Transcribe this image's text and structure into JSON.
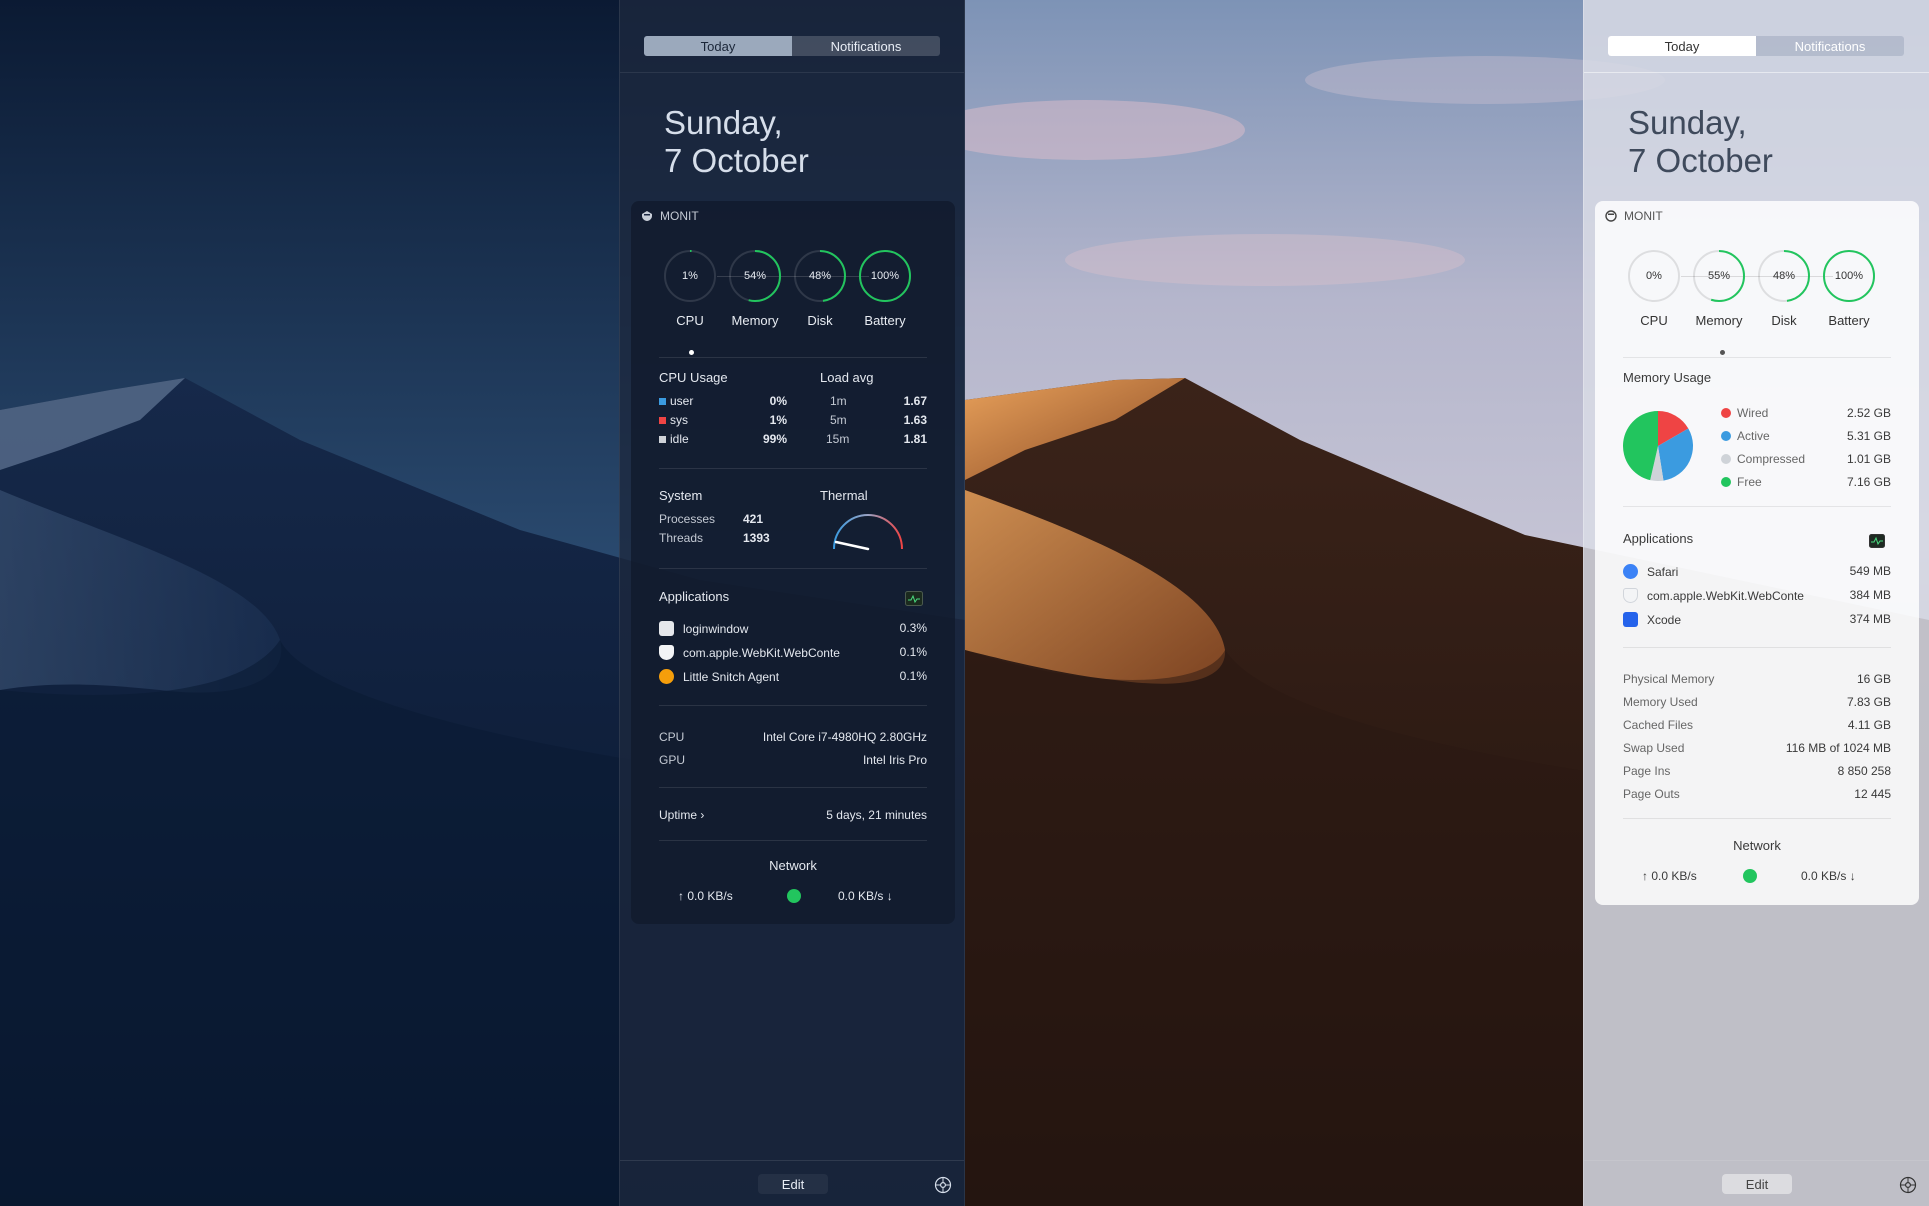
{
  "tabs": {
    "today": "Today",
    "notifications": "Notifications"
  },
  "date": {
    "line1": "Sunday,",
    "line2": "7 October"
  },
  "footer": {
    "edit": "Edit",
    "settings_icon": "gear-icon"
  },
  "colors": {
    "ring_green": "#22c55e",
    "user_blue": "#3b9be0",
    "sys_red": "#ef4444",
    "wired_red": "#ef4444",
    "active_blue": "#3b9be0",
    "compressed_gray": "#cfd3d8",
    "free_green": "#22c55e"
  },
  "dark": {
    "title": "MONIT",
    "gauges": [
      {
        "label": "CPU",
        "value": "1%",
        "fraction": 0.01
      },
      {
        "label": "Memory",
        "value": "54%",
        "fraction": 0.54
      },
      {
        "label": "Disk",
        "value": "48%",
        "fraction": 0.48
      },
      {
        "label": "Battery",
        "value": "100%",
        "fraction": 1.0
      }
    ],
    "cpu_usage": {
      "title": "CPU Usage",
      "rows": [
        {
          "label": "user",
          "value": "0%"
        },
        {
          "label": "sys",
          "value": "1%"
        },
        {
          "label": "idle",
          "value": "99%"
        }
      ]
    },
    "load_avg": {
      "title": "Load avg",
      "rows": [
        {
          "label": "1m",
          "value": "1.67"
        },
        {
          "label": "5m",
          "value": "1.63"
        },
        {
          "label": "15m",
          "value": "1.81"
        }
      ]
    },
    "system": {
      "title": "System",
      "processes_label": "Processes",
      "processes": "421",
      "threads_label": "Threads",
      "threads": "1393"
    },
    "thermal": {
      "title": "Thermal"
    },
    "applications": {
      "title": "Applications",
      "items": [
        {
          "name": "loginwindow",
          "value": "0.3%"
        },
        {
          "name": "com.apple.WebKit.WebConte",
          "value": "0.1%"
        },
        {
          "name": "Little Snitch Agent",
          "value": "0.1%"
        }
      ]
    },
    "hardware": {
      "cpu_label": "CPU",
      "cpu": "Intel Core i7-4980HQ 2.80GHz",
      "gpu_label": "GPU",
      "gpu": "Intel Iris Pro"
    },
    "uptime": {
      "label": "Uptime ›",
      "value": "5 days, 21 minutes"
    },
    "network": {
      "title": "Network",
      "up": "↑ 0.0 KB/s",
      "down": "0.0 KB/s ↓"
    }
  },
  "light": {
    "title": "MONIT",
    "gauges": [
      {
        "label": "CPU",
        "value": "0%",
        "fraction": 0.0
      },
      {
        "label": "Memory",
        "value": "55%",
        "fraction": 0.55
      },
      {
        "label": "Disk",
        "value": "48%",
        "fraction": 0.48
      },
      {
        "label": "Battery",
        "value": "100%",
        "fraction": 1.0
      }
    ],
    "memory_usage": {
      "title": "Memory Usage",
      "legend": [
        {
          "label": "Wired",
          "value": "2.52 GB"
        },
        {
          "label": "Active",
          "value": "5.31 GB"
        },
        {
          "label": "Compressed",
          "value": "1.01 GB"
        },
        {
          "label": "Free",
          "value": "7.16 GB"
        }
      ]
    },
    "applications": {
      "title": "Applications",
      "items": [
        {
          "name": "Safari",
          "value": "549 MB"
        },
        {
          "name": "com.apple.WebKit.WebConte",
          "value": "384 MB"
        },
        {
          "name": "Xcode",
          "value": "374 MB"
        }
      ]
    },
    "stats": [
      {
        "label": "Physical Memory",
        "value": "16 GB"
      },
      {
        "label": "Memory Used",
        "value": "7.83 GB"
      },
      {
        "label": "Cached Files",
        "value": "4.11 GB"
      },
      {
        "label": "Swap Used",
        "value": "116 MB of 1024 MB"
      },
      {
        "label": "Page Ins",
        "value": "8 850 258"
      },
      {
        "label": "Page Outs",
        "value": "12 445"
      }
    ],
    "network": {
      "title": "Network",
      "up": "↑ 0.0 KB/s",
      "down": "0.0 KB/s ↓"
    }
  }
}
